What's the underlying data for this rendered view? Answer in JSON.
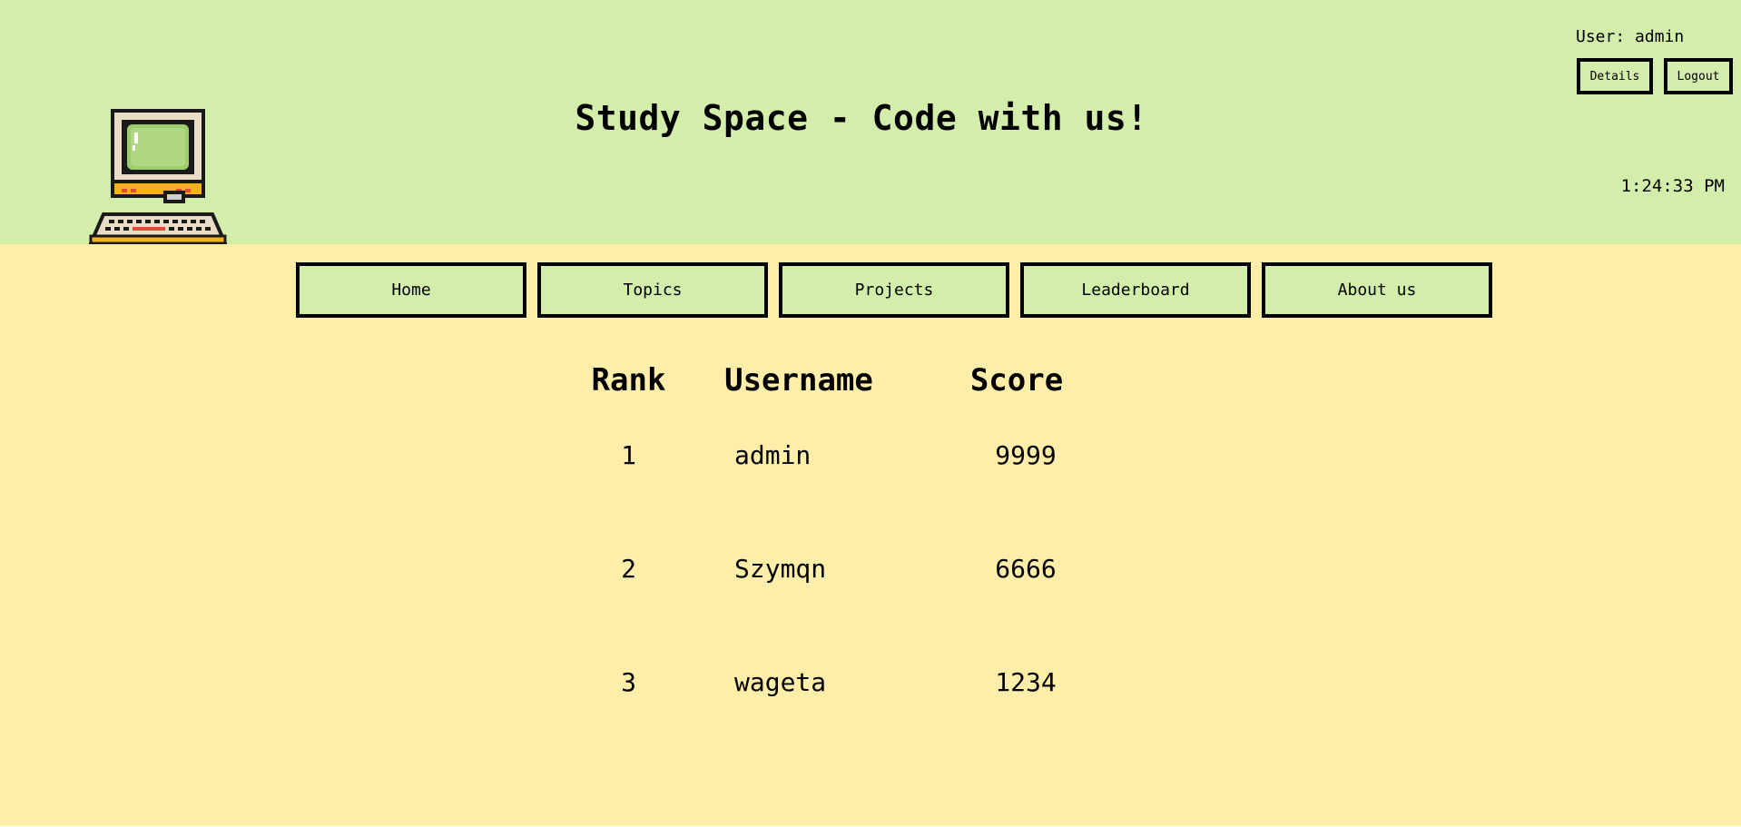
{
  "header": {
    "title": "Study Space - Code with us!",
    "user_label": "User:",
    "username": "admin",
    "details_label": "Details",
    "logout_label": "Logout",
    "clock": "1:24:33 PM",
    "logo_icon": "retro-computer-icon"
  },
  "nav": {
    "items": [
      {
        "label": "Home"
      },
      {
        "label": "Topics"
      },
      {
        "label": "Projects"
      },
      {
        "label": "Leaderboard"
      },
      {
        "label": "About us"
      }
    ]
  },
  "leaderboard": {
    "columns": [
      "Rank",
      "Username",
      "Score"
    ],
    "rows": [
      {
        "rank": "1",
        "username": "admin",
        "score": "9999"
      },
      {
        "rank": "2",
        "username": "Szymqn",
        "score": "6666"
      },
      {
        "rank": "3",
        "username": "wageta",
        "score": "1234"
      }
    ]
  },
  "colors": {
    "header_bg": "#d3eeaa",
    "content_bg": "#ffeeaa",
    "button_bg": "#d3eeaa",
    "border": "#000000"
  }
}
